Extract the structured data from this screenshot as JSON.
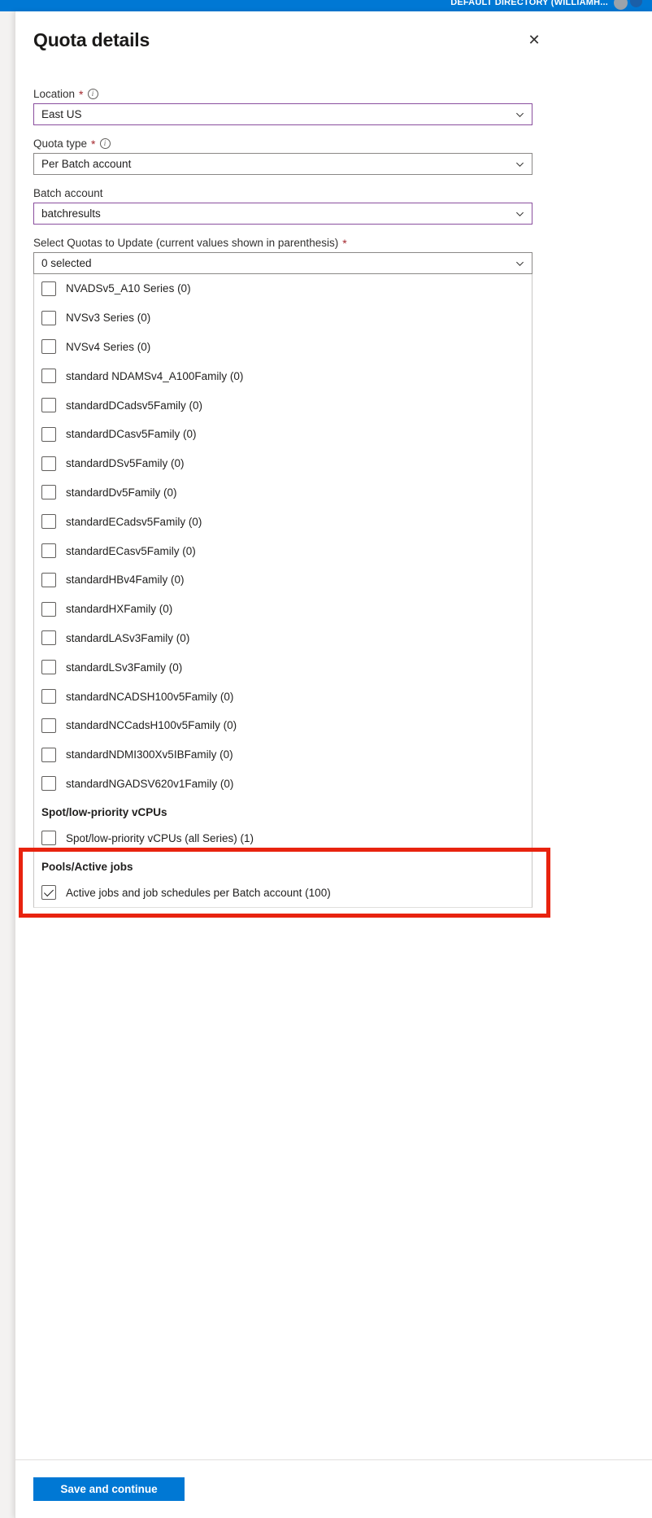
{
  "topbar": {
    "directory": "DEFAULT DIRECTORY (WILLIAMH...",
    "avatar_name": "user-avatar",
    "accent_color": "#0078d4"
  },
  "blade": {
    "title": "Quota details",
    "close_label": "✕"
  },
  "form": {
    "location": {
      "label": "Location",
      "required": "*",
      "info": "i",
      "value": "East US",
      "accent_color": "#8a4f9e"
    },
    "quota_type": {
      "label": "Quota type",
      "required": "*",
      "info": "i",
      "value": "Per Batch account"
    },
    "batch_account": {
      "label": "Batch account",
      "value": "batchresults",
      "accent_color": "#8a4f9e"
    },
    "select_quotas": {
      "label": "Select Quotas to Update (current values shown in parenthesis)",
      "required": "*",
      "value": "0 selected"
    }
  },
  "quota_list": {
    "items": [
      {
        "label": "NVADSv5_A10 Series (0)",
        "checked": false
      },
      {
        "label": "NVSv3 Series (0)",
        "checked": false
      },
      {
        "label": "NVSv4 Series (0)",
        "checked": false
      },
      {
        "label": "standard NDAMSv4_A100Family (0)",
        "checked": false
      },
      {
        "label": "standardDCadsv5Family (0)",
        "checked": false
      },
      {
        "label": "standardDCasv5Family (0)",
        "checked": false
      },
      {
        "label": "standardDSv5Family (0)",
        "checked": false
      },
      {
        "label": "standardDv5Family (0)",
        "checked": false
      },
      {
        "label": "standardECadsv5Family (0)",
        "checked": false
      },
      {
        "label": "standardECasv5Family (0)",
        "checked": false
      },
      {
        "label": "standardHBv4Family (0)",
        "checked": false
      },
      {
        "label": "standardHXFamily (0)",
        "checked": false
      },
      {
        "label": "standardLASv3Family (0)",
        "checked": false
      },
      {
        "label": "standardLSv3Family (0)",
        "checked": false
      },
      {
        "label": "standardNCADSH100v5Family (0)",
        "checked": false
      },
      {
        "label": "standardNCCadsH100v5Family (0)",
        "checked": false
      },
      {
        "label": "standardNDMI300Xv5IBFamily (0)",
        "checked": false
      },
      {
        "label": "standardNGADSV620v1Family (0)",
        "checked": false
      }
    ],
    "groups": [
      {
        "header": "Spot/low-priority vCPUs",
        "items": [
          {
            "label": "Spot/low-priority vCPUs (all Series) (1)",
            "checked": false
          }
        ]
      },
      {
        "header": "Pools/Active jobs",
        "items": [
          {
            "label": "Active jobs and job schedules per Batch account (100)",
            "checked": true
          }
        ]
      }
    ]
  },
  "highlight": {
    "color": "#e8230f",
    "name": "pools-active-jobs-highlight"
  },
  "footer": {
    "save_label": "Save and continue",
    "accent_color": "#0078d4"
  }
}
